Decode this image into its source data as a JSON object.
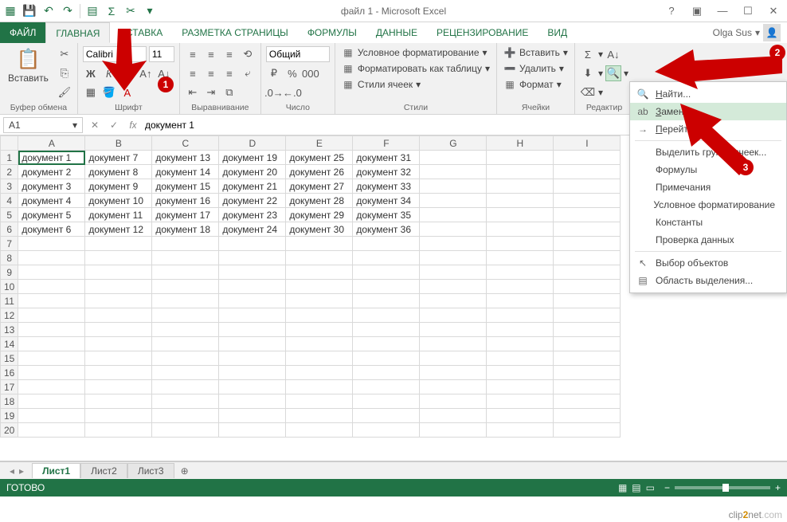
{
  "title": "файл 1 - Microsoft Excel",
  "user": "Olga Sus",
  "tabs": {
    "file": "ФАЙЛ",
    "home": "ГЛАВНАЯ",
    "insert": "ВСТАВКА",
    "layout": "РАЗМЕТКА СТРАНИЦЫ",
    "formulas": "ФОРМУЛЫ",
    "data": "ДАННЫЕ",
    "review": "РЕЦЕНЗИРОВАНИЕ",
    "view": "ВИД"
  },
  "ribbon": {
    "clipboard": {
      "paste": "Вставить",
      "label": "Буфер обмена"
    },
    "font": {
      "name": "Calibri",
      "size": "11",
      "label": "Шрифт"
    },
    "alignment": {
      "label": "Выравнивание"
    },
    "number": {
      "format": "Общий",
      "label": "Число"
    },
    "styles": {
      "cond": "Условное форматирование",
      "table": "Форматировать как таблицу",
      "cell": "Стили ячеек",
      "label": "Стили"
    },
    "cells": {
      "insert": "Вставить",
      "delete": "Удалить",
      "format": "Формат",
      "label": "Ячейки"
    },
    "editing": {
      "label": "Редактир"
    }
  },
  "namebox": "A1",
  "formula": "документ 1",
  "columns": [
    "A",
    "B",
    "C",
    "D",
    "E",
    "F",
    "G",
    "H",
    "I"
  ],
  "rows": [
    [
      "документ 1",
      "документ 7",
      "документ 13",
      "документ 19",
      "документ 25",
      "документ 31",
      "",
      "",
      ""
    ],
    [
      "документ 2",
      "документ 8",
      "документ 14",
      "документ 20",
      "документ 26",
      "документ 32",
      "",
      "",
      ""
    ],
    [
      "документ 3",
      "документ 9",
      "документ 15",
      "документ 21",
      "документ 27",
      "документ 33",
      "",
      "",
      ""
    ],
    [
      "документ 4",
      "документ 10",
      "документ 16",
      "документ 22",
      "документ 28",
      "документ 34",
      "",
      "",
      ""
    ],
    [
      "документ 5",
      "документ 11",
      "документ 17",
      "документ 23",
      "документ 29",
      "документ 35",
      "",
      "",
      ""
    ],
    [
      "документ 6",
      "документ 12",
      "документ 18",
      "документ 24",
      "документ 30",
      "документ 36",
      "",
      "",
      ""
    ]
  ],
  "emptyRowCount": 14,
  "sheets": {
    "s1": "Лист1",
    "s2": "Лист2",
    "s3": "Лист3"
  },
  "status": "ГОТОВО",
  "zoom": "100%",
  "findMenu": {
    "find": "Найти...",
    "replace": "Заменить...",
    "goto": "Перейти...",
    "selectGroup": "Выделить группу ячеек...",
    "formulas": "Формулы",
    "comments": "Примечания",
    "cond": "Условное форматирование",
    "constants": "Константы",
    "validation": "Проверка данных",
    "objects": "Выбор объектов",
    "pane": "Область выделения..."
  },
  "badges": {
    "b1": "1",
    "b2": "2",
    "b3": "3"
  },
  "watermark": {
    "a": "clip",
    "b": "2",
    "c": "net",
    "d": ".com"
  }
}
